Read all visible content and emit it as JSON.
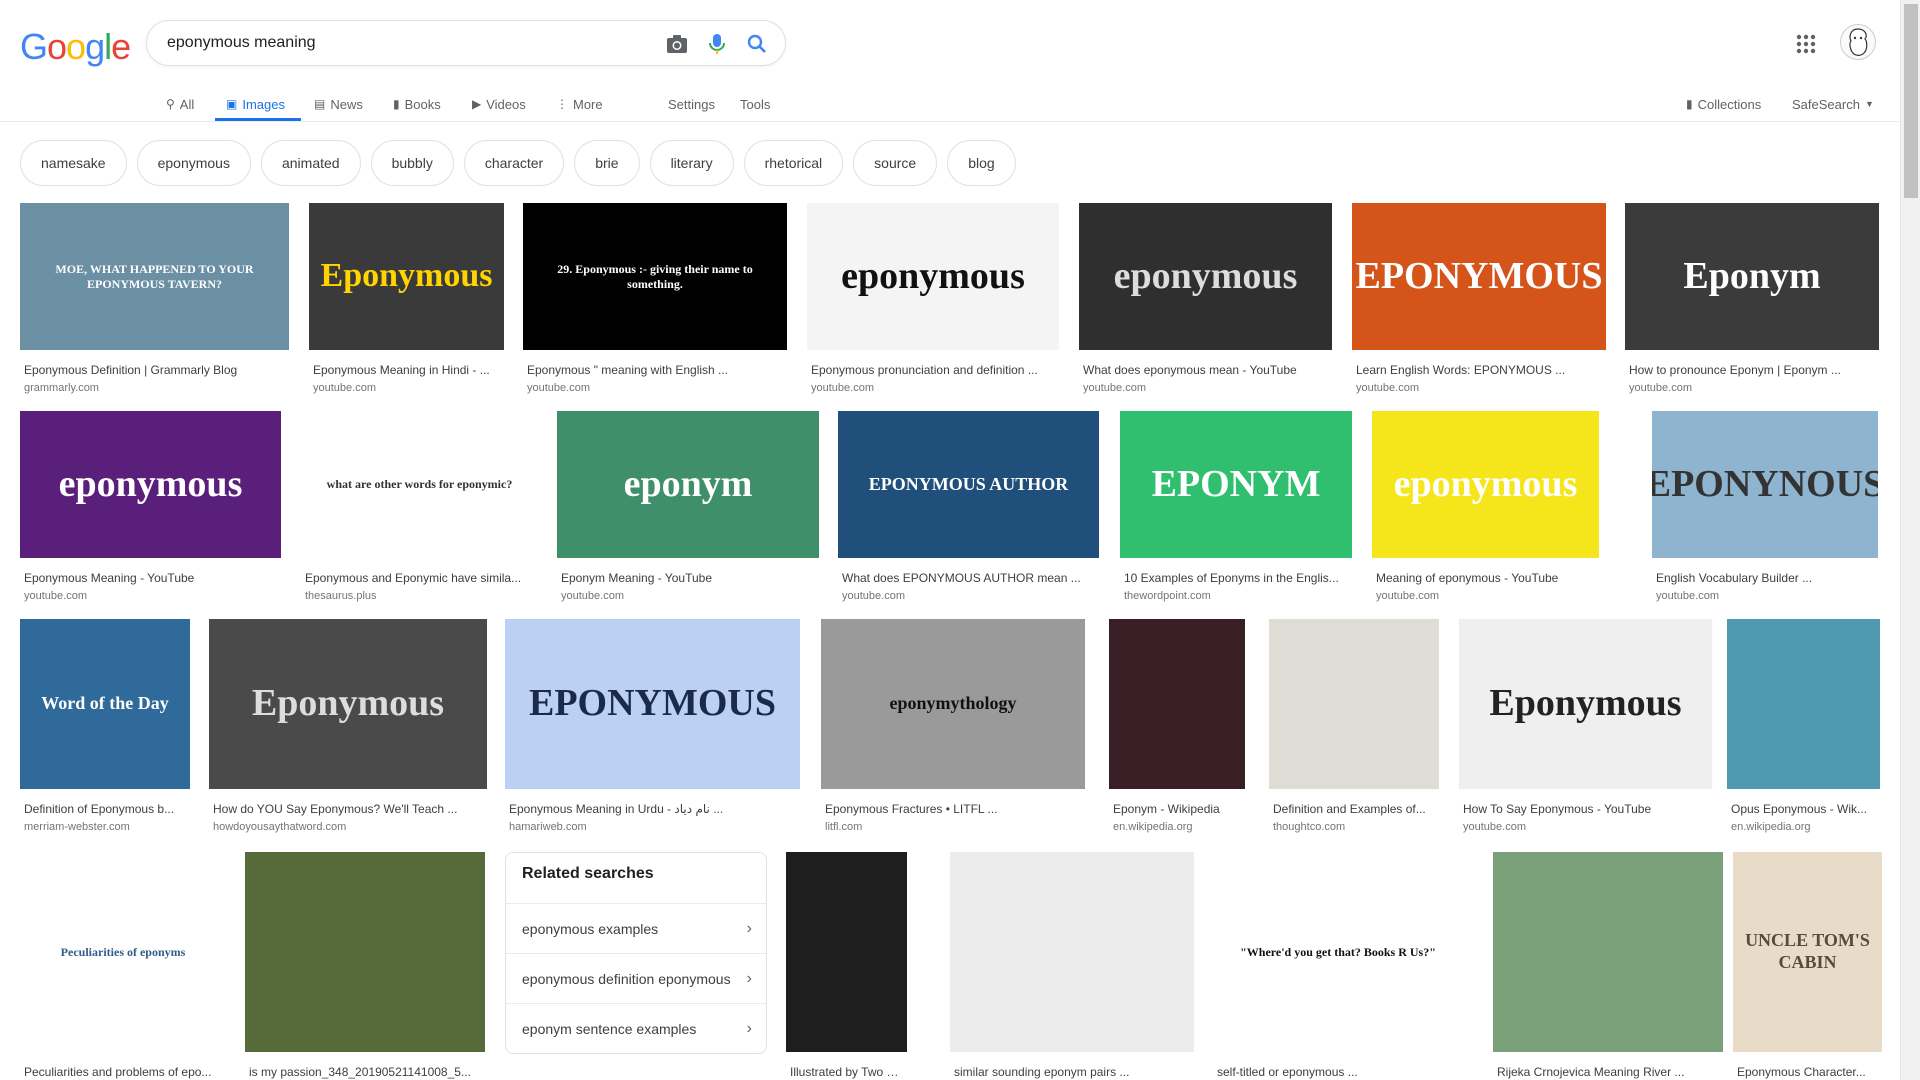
{
  "logo": [
    "G",
    "o",
    "o",
    "g",
    "l",
    "e"
  ],
  "logo_colors": [
    "#4285f4",
    "#ea4335",
    "#fbbc05",
    "#4285f4",
    "#34a853",
    "#ea4335"
  ],
  "search": {
    "value": "eponymous meaning"
  },
  "nav": {
    "all": "All",
    "images": "Images",
    "news": "News",
    "books": "Books",
    "videos": "Videos",
    "more": "More",
    "settings": "Settings",
    "tools": "Tools",
    "collections": "Collections",
    "safesearch": "SafeSearch"
  },
  "chips": [
    "namesake",
    "eponymous",
    "animated",
    "bubbly",
    "character",
    "brie",
    "literary",
    "rhetorical",
    "source",
    "blog"
  ],
  "images": [
    {
      "caption": "Eponymous Definition | Grammarly Blog",
      "source": "grammarly.com",
      "thumb_text": "MOE, WHAT HAPPENED TO YOUR EPONYMOUS TAVERN?",
      "bg": "#6b8fa3",
      "fg": "#ffffff"
    },
    {
      "caption": "Eponymous Meaning in Hindi - ...",
      "source": "youtube.com",
      "thumb_text": "Eponymous",
      "bg": "#3a3a3a",
      "fg": "#ffd400"
    },
    {
      "caption": "Eponymous \" meaning with English ...",
      "source": "youtube.com",
      "thumb_text": "29. Eponymous :- giving their name to something.",
      "bg": "#000000",
      "fg": "#ffffff"
    },
    {
      "caption": "Eponymous pronunciation and definition ...",
      "source": "youtube.com",
      "thumb_text": "eponymous",
      "bg": "#f4f4f4",
      "fg": "#111111"
    },
    {
      "caption": "What does eponymous mean - YouTube",
      "source": "youtube.com",
      "thumb_text": "eponymous",
      "bg": "#2f2f2f",
      "fg": "#dddddd"
    },
    {
      "caption": "Learn English Words: EPONYMOUS ...",
      "source": "youtube.com",
      "thumb_text": "EPONYMOUS",
      "bg": "#d4541a",
      "fg": "#ffffff"
    },
    {
      "caption": "How to pronounce Eponym | Eponym ...",
      "source": "youtube.com",
      "thumb_text": "Eponym",
      "bg": "#3b3b3b",
      "fg": "#ffffff"
    },
    {
      "caption": "Eponymous Meaning - YouTube",
      "source": "youtube.com",
      "thumb_text": "eponymous",
      "bg": "#5a1f7a",
      "fg": "#ffffff"
    },
    {
      "caption": "Eponymous and Eponymic have simila...",
      "source": "thesaurus.plus",
      "thumb_text": "what are other words for eponymic?",
      "bg": "#ffffff",
      "fg": "#333333"
    },
    {
      "caption": "Eponym Meaning - YouTube",
      "source": "youtube.com",
      "thumb_text": "eponym",
      "bg": "#3e8f6a",
      "fg": "#ffffff"
    },
    {
      "caption": "What does EPONYMOUS AUTHOR mean ...",
      "source": "youtube.com",
      "thumb_text": "EPONYMOUS AUTHOR",
      "bg": "#1f4f7a",
      "fg": "#ffffff"
    },
    {
      "caption": "10 Examples of Eponyms in the Englis...",
      "source": "thewordpoint.com",
      "thumb_text": "EPONYM",
      "bg": "#2fbf6f",
      "fg": "#ffffff"
    },
    {
      "caption": "Meaning of eponymous - YouTube",
      "source": "youtube.com",
      "thumb_text": "eponymous",
      "bg": "#f5e51b",
      "fg": "#ffffff"
    },
    {
      "caption": "English Vocabulary Builder ...",
      "source": "youtube.com",
      "thumb_text": "EPONYNOUS",
      "bg": "#8fb4cf",
      "fg": "#333333"
    },
    {
      "caption": "Definition of Eponymous b...",
      "source": "merriam-webster.com",
      "thumb_text": "Word of the Day",
      "bg": "#2f6a9a",
      "fg": "#ffffff"
    },
    {
      "caption": "How do YOU Say Eponymous? We'll Teach ...",
      "source": "howdoyousaythatword.com",
      "thumb_text": "Eponymous",
      "bg": "#4a4a4a",
      "fg": "#dddddd"
    },
    {
      "caption": "Eponymous Meaning in Urdu - نام دیاد ...",
      "source": "hamariweb.com",
      "thumb_text": "EPONYMOUS",
      "bg": "#bcd0f3",
      "fg": "#1a2a4a"
    },
    {
      "caption": "Eponymous Fractures • LITFL ...",
      "source": "litfl.com",
      "thumb_text": "eponymythology",
      "bg": "#9a9a9a",
      "fg": "#111111"
    },
    {
      "caption": "Eponym - Wikipedia",
      "source": "en.wikipedia.org",
      "thumb_text": "",
      "bg": "#3a1e26",
      "fg": "#ffffff"
    },
    {
      "caption": "Definition and Examples of...",
      "source": "thoughtco.com",
      "thumb_text": "",
      "bg": "#e0ddd7",
      "fg": "#333333"
    },
    {
      "caption": "How To Say Eponymous - YouTube",
      "source": "youtube.com",
      "thumb_text": "Eponymous",
      "bg": "#efefef",
      "fg": "#222222"
    },
    {
      "caption": "Opus Eponymous - Wik...",
      "source": "en.wikipedia.org",
      "thumb_text": "",
      "bg": "#4f9ab0",
      "fg": "#ffffff"
    },
    {
      "caption": "Peculiarities and problems of epo...",
      "source": "",
      "thumb_text": "Peculiarities of eponyms",
      "bg": "#ffffff",
      "fg": "#2f5d8a"
    },
    {
      "caption": "is my passion_348_20190521141008_5...",
      "source": "",
      "thumb_text": "",
      "bg": "#556b3a",
      "fg": "#ffffff"
    },
    {
      "caption": "Illustrated by Two Epo...",
      "source": "",
      "thumb_text": "",
      "bg": "#1e1e1e",
      "fg": "#dddddd"
    },
    {
      "caption": "similar sounding eponym pairs ...",
      "source": "",
      "thumb_text": "",
      "bg": "#ececec",
      "fg": "#555555"
    },
    {
      "caption": "self-titled or eponymous ...",
      "source": "",
      "thumb_text": "\"Where'd you get that? Books R Us?\"",
      "bg": "#ffffff",
      "fg": "#111111"
    },
    {
      "caption": "Rijeka Crnojevica Meaning River ...",
      "source": "",
      "thumb_text": "",
      "bg": "#7aa07a",
      "fg": "#ffffff"
    },
    {
      "caption": "Eponymous Character...",
      "source": "",
      "thumb_text": "UNCLE TOM'S CABIN",
      "bg": "#e8dcc8",
      "fg": "#5a4a3a"
    }
  ],
  "related": {
    "title": "Related searches",
    "items": [
      "eponymous examples",
      "eponymous definition eponymous",
      "eponym sentence examples"
    ]
  }
}
